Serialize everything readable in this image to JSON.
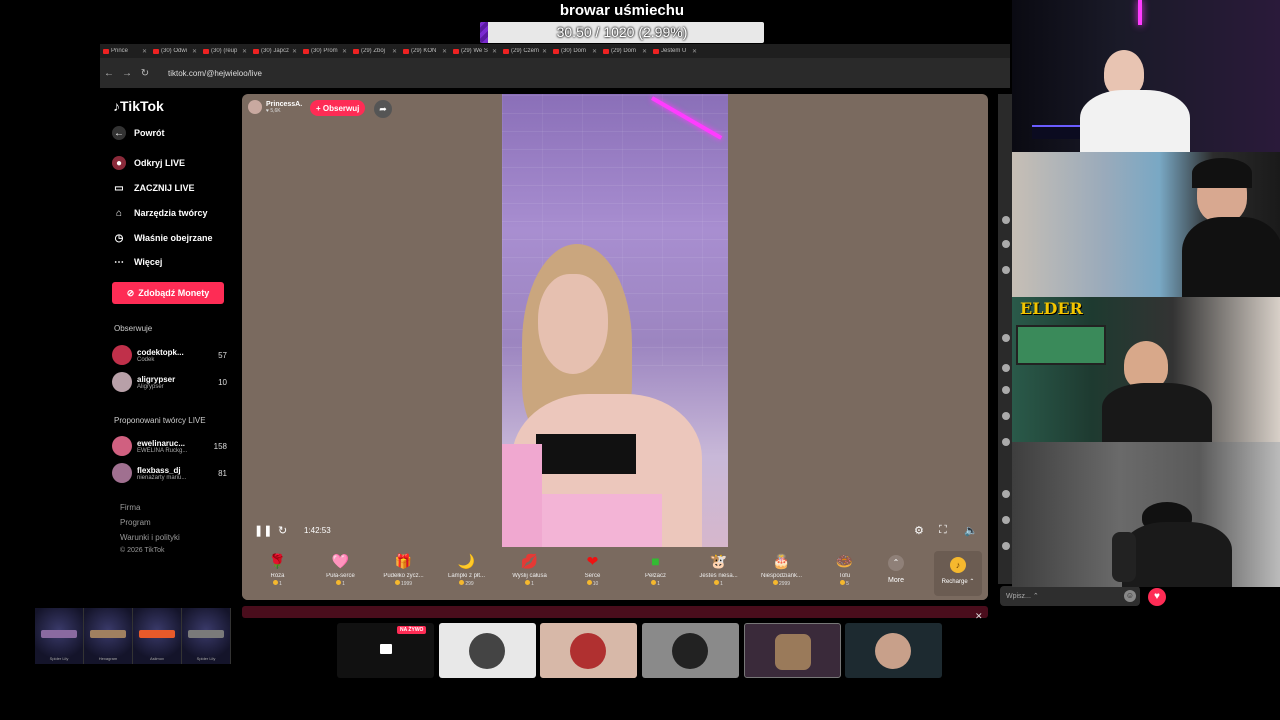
{
  "overlay": {
    "goal_title": "browar uśmiechu",
    "goal_text": "30.50 / 1020 (2.99%)",
    "goal_progress": 0.0299,
    "goal_color": "#7a2ad0"
  },
  "browser": {
    "url": "tiktok.com/@hejwieloo/live",
    "tabs": [
      "Prince",
      "(30) Odwi",
      "(30) (reup",
      "(30) Japcz",
      "(30) Prom",
      "(29) Zboj",
      "(29) KON",
      "(29) We S",
      "(29) Czem",
      "(30) Dom",
      "(29) Dom",
      "Jestem U"
    ]
  },
  "sidebar": {
    "logo": "TikTok",
    "back_label": "Powrót",
    "items": [
      {
        "label": "Odkryj LIVE",
        "icon": "live-discover-icon"
      },
      {
        "label": "ZACZNIJ LIVE",
        "icon": "camera-icon"
      },
      {
        "label": "Narzędzia twórcy",
        "icon": "house-icon"
      },
      {
        "label": "Właśnie obejrzane",
        "icon": "history-icon"
      },
      {
        "label": "Więcej",
        "icon": "more-icon"
      }
    ],
    "coins_button": "Zdobądź Monety",
    "following_title": "Obserwuje",
    "following": [
      {
        "name": "codektopk...",
        "sub": "Codek",
        "count": "57"
      },
      {
        "name": "aligrypser",
        "sub": "Aligrypser",
        "count": "10"
      }
    ],
    "suggested_title": "Proponowani twórcy LIVE",
    "suggested": [
      {
        "name": "ewelinaruc...",
        "sub": "EWELINA Ruckg...",
        "count": "158"
      },
      {
        "name": "flexbass_dj",
        "sub": "nienażarty mariu...",
        "count": "81"
      }
    ],
    "footer": [
      "Firma",
      "Program",
      "Warunki i polityki",
      "© 2026 TikTok"
    ]
  },
  "player": {
    "creator_name": "PrincessA.",
    "creator_likes": "♥ 5,6K",
    "follow_label": "+ Obserwuj",
    "timer": "1:42:53"
  },
  "gifts": [
    {
      "name": "Róża",
      "price": "1",
      "icon": "🌹"
    },
    {
      "name": "Puła-serce",
      "price": "1",
      "icon": "🩷"
    },
    {
      "name": "Pudełko życz...",
      "price": "1999",
      "icon": "🎁"
    },
    {
      "name": "Lampki z płt...",
      "price": "299",
      "icon": "🌙"
    },
    {
      "name": "Wyślij całusa",
      "price": "1",
      "icon": "💋"
    },
    {
      "name": "Serce",
      "price": "10",
      "icon": "❤"
    },
    {
      "name": "Pełzacz",
      "price": "1",
      "icon": "■"
    },
    {
      "name": "Jesteś niesa...",
      "price": "1",
      "icon": "🐮"
    },
    {
      "name": "Niespodziank...",
      "price": "2999",
      "icon": "🎂"
    },
    {
      "name": "Tofu",
      "price": "5",
      "icon": "🍩"
    }
  ],
  "more_label": "More",
  "recharge_label": "Recharge ⌃",
  "chat": {
    "placeholder": "Wpisz... ⌃"
  },
  "cams": {
    "cam3_label": "ELDER"
  },
  "skins": [
    "Spider Lily",
    "Hexagram",
    "Asiimov",
    "Spider Lily"
  ],
  "live_badge": "NA ŻYWO"
}
